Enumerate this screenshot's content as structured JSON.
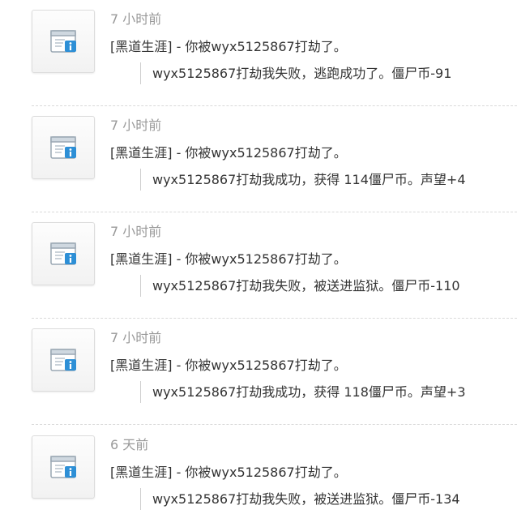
{
  "feed": {
    "entries": [
      {
        "time": "7 小时前",
        "title": "[黑道生涯] - 你被wyx5125867打劫了。",
        "detail": "wyx5125867打劫我失败，逃跑成功了。僵尸币-91",
        "icon": "info-window-icon"
      },
      {
        "time": "7 小时前",
        "title": "[黑道生涯] - 你被wyx5125867打劫了。",
        "detail": "wyx5125867打劫我成功，获得 114僵尸币。声望+4",
        "icon": "info-window-icon"
      },
      {
        "time": "7 小时前",
        "title": "[黑道生涯] - 你被wyx5125867打劫了。",
        "detail": "wyx5125867打劫我失败，被送进监狱。僵尸币-110",
        "icon": "info-window-icon"
      },
      {
        "time": "7 小时前",
        "title": "[黑道生涯] - 你被wyx5125867打劫了。",
        "detail": "wyx5125867打劫我成功，获得 118僵尸币。声望+3",
        "icon": "info-window-icon"
      },
      {
        "time": "6 天前",
        "title": "[黑道生涯] - 你被wyx5125867打劫了。",
        "detail": "wyx5125867打劫我失败，被送进监狱。僵尸币-134",
        "icon": "info-window-icon"
      }
    ]
  },
  "colors": {
    "time_text": "#999999",
    "body_text": "#333333",
    "icon_blue": "#2d8fd6",
    "separator": "#d9d9d9"
  }
}
